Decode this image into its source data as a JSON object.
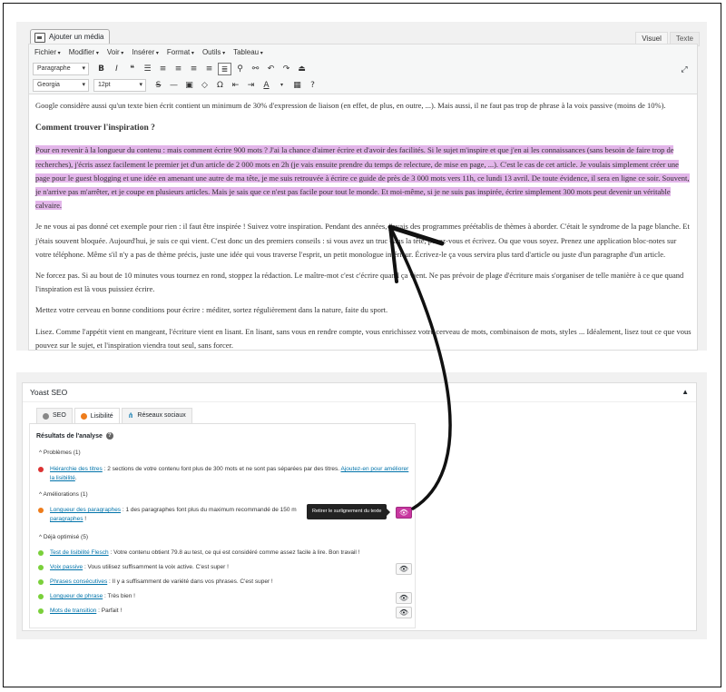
{
  "editor": {
    "media_button": "Ajouter un média",
    "tabs": [
      "Visuel",
      "Texte"
    ],
    "menus": [
      "Fichier",
      "Modifier",
      "Voir",
      "Insérer",
      "Format",
      "Outils",
      "Tableau"
    ],
    "format_select": "Paragraphe",
    "font_select": "Georgia",
    "size_select": "12pt",
    "paragraphs": {
      "p1": "Google considère aussi qu'un texte bien écrit contient un minimum de 30% d'expression de liaison (en effet, de plus, en outre, ...). Mais aussi, il ne faut pas trop de phrase à la voix passive (moins de 10%).",
      "heading": "Comment trouver l'inspiration ?",
      "highlighted": "Pour en revenir à la longueur du contenu : mais comment écrire 900 mots ? J'ai la chance d'aimer écrire et d'avoir des facilités. Si le sujet m'inspire et que j'en ai les connaissances (sans besoin de faire trop de recherches), j'écris assez facilement le premier jet d'un article de 2 000 mots en 2h (je vais ensuite prendre du temps de relecture, de mise en page, ...). C'est le cas de cet article. Je voulais simplement créer une page pour le guest blogging et une idée en amenant une autre de ma tête, je me suis retrouvée à écrire ce guide de près de 3 000 mots vers 11h, ce lundi 13 avril. De toute évidence, il sera en ligne ce soir. Souvent, je n'arrive pas m'arrêter, et je coupe en plusieurs articles. Mais je sais que ce n'est pas facile pour tout le monde. Et moi-même, si je ne suis pas inspirée, écrire simplement 300 mots peut devenir un véritable calvaire.",
      "p3": "Je ne vous ai pas donné cet exemple pour rien : il faut être inspirée ! Suivez votre inspiration. Pendant des années, j'avais des programmes préétablis de thèmes à aborder. C'était le syndrome de la page blanche. Et j'étais souvent bloquée. Aujourd'hui, je suis ce qui vient. C'est donc un des premiers conseils : si vous avez un truc dans la tête, posez-vous et écrivez. Ou que vous soyez. Prenez une application bloc-notes sur votre téléphone. Même s'il n'y a pas de thème précis, juste une idée qui vous traverse l'esprit, un petit monologue intérieur. Écrivez-le ça vous servira plus tard d'article ou juste d'un paragraphe d'un article.",
      "p4": "Ne forcez pas. Si au bout de 10 minutes vous tournez en rond, stoppez la rédaction. Le maître-mot c'est c'écrire quand ça vient. Ne pas prévoir de plage d'écriture mais s'organiser de telle manière à ce que quand l'inspiration est là vous puissiez écrire.",
      "p5": "Mettez votre cerveau en bonne conditions pour écrire : méditer, sortez régulièrement dans la nature, faite du sport.",
      "p6": "Lisez. Comme l'appétit vient en mangeant, l'écriture vient en lisant. En lisant, sans vous en rendre compte, vous enrichissez votre cerveau de mots, combinaison de mots, styles ... Idéalement, lisez tout ce que vous pouvez sur le sujet, et l'inspiration viendra tout seul, sans forcer."
    }
  },
  "yoast": {
    "title": "Yoast SEO",
    "tabs": [
      "SEO",
      "Lisibilité",
      "Réseaux sociaux"
    ],
    "analysis_title": "Résultats de l'analyse",
    "sections": {
      "problems": "Problèmes (1)",
      "improvements": "Améliorations (1)",
      "optimized": "Déjà optimisé (5)"
    },
    "items": [
      {
        "link": "Hiérarchie des titres",
        "text": " : 2 sections de votre contenu font plus de 300 mots et ne sont pas séparées par des titres. ",
        "link2": "Ajoutez-en pour améliorer la lisibilité",
        "end": "."
      },
      {
        "link": "Longueur des paragraphes",
        "text": " : 1 des paragraphes font plus du maximum recommandé de 150 m",
        "link2": "paragraphes",
        "end": " !"
      },
      {
        "link": "Test de lisibilité Flesch",
        "text": " : Votre contenu obtient 79.8 au test, ce qui est considéré comme assez facile à lire. Bon travail !"
      },
      {
        "link": "Voix passive",
        "text": " : Vous utilisez suffisamment la voix active. C'est super !"
      },
      {
        "link": "Phrases consécutives",
        "text": " : Il y a suffisamment de variété dans vos phrases. C'est super !"
      },
      {
        "link": "Longueur de phrase",
        "text": " : Très bien !"
      },
      {
        "link": "Mots de transition",
        "text": " : Parfait !"
      }
    ],
    "tooltip": "Retirer le surlignement du texte",
    "colors": {
      "red": "#dc3232",
      "orange": "#ee7c1b",
      "green": "#7ad03a",
      "gray": "#888888",
      "highlight": "#e3b6ea",
      "eye_active": "#c837a0"
    }
  }
}
